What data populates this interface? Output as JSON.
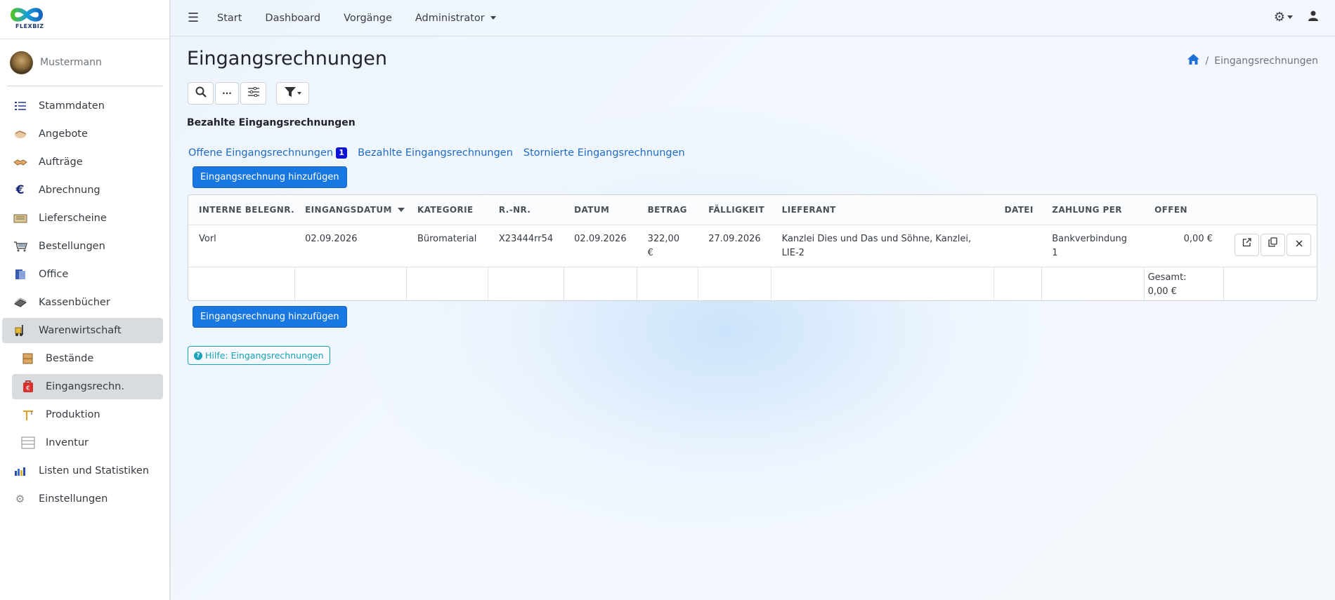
{
  "brand": {
    "name": "FLEXBIZ"
  },
  "user": {
    "name": "Mustermann"
  },
  "sidebar": {
    "items": [
      {
        "label": "Stammdaten",
        "icon": "list-icon"
      },
      {
        "label": "Angebote",
        "icon": "handshake-icon"
      },
      {
        "label": "Aufträge",
        "icon": "handshake-icon"
      },
      {
        "label": "Abrechnung",
        "icon": "euro-icon"
      },
      {
        "label": "Lieferscheine",
        "icon": "delivery-icon"
      },
      {
        "label": "Bestellungen",
        "icon": "cart-icon"
      },
      {
        "label": "Office",
        "icon": "book-icon"
      },
      {
        "label": "Kassenbücher",
        "icon": "cashbook-icon"
      },
      {
        "label": "Warenwirtschaft",
        "icon": "forklift-icon"
      }
    ],
    "subitems": [
      {
        "label": "Bestände",
        "icon": "boxes-icon"
      },
      {
        "label": "Eingangsrechn.",
        "icon": "invoice-icon"
      },
      {
        "label": "Produktion",
        "icon": "crane-icon"
      },
      {
        "label": "Inventur",
        "icon": "shelf-icon"
      }
    ],
    "bottom_items": [
      {
        "label": "Listen und Statistiken",
        "icon": "chart-icon"
      },
      {
        "label": "Einstellungen",
        "icon": "gear-icon"
      }
    ]
  },
  "topnav": {
    "start": "Start",
    "dashboard": "Dashboard",
    "vorgaenge": "Vorgänge",
    "admin": "Administrator"
  },
  "page": {
    "title": "Eingangsrechnungen",
    "breadcrumb_current": "Eingangsrechnungen",
    "section_title": "Bezahlte Eingangsrechnungen",
    "toolbar_more": "···"
  },
  "tabs": {
    "offene": "Offene Eingangsrechnungen",
    "offene_count": "1",
    "bezahlte": "Bezahlte Eingangsrechnungen",
    "stornierte": "Stornierte Eingangsrechnungen"
  },
  "buttons": {
    "add_top": "Eingangsrechnung hinzufügen",
    "add_bottom": "Eingangsrechnung hinzufügen",
    "help": "Hilfe: Eingangsrechnungen"
  },
  "table": {
    "headers": {
      "belegnr": "INTERNE BELEGNR.",
      "eingangsdatum": "EINGANGSDATUM",
      "kategorie": "KATEGORIE",
      "rnr": "R.-NR.",
      "datum": "DATUM",
      "betrag": "BETRAG",
      "faelligkeit": "FÄLLIGKEIT",
      "lieferant": "LIEFERANT",
      "datei": "DATEI",
      "zahlung": "ZAHLUNG PER",
      "offen": "OFFEN"
    },
    "rows": [
      {
        "belegnr": "Vorl",
        "eingangsdatum": "02.09.2026",
        "kategorie": "Büromaterial",
        "rnr": "X23444rr54",
        "datum": "02.09.2026",
        "betrag": "322,00 €",
        "faelligkeit": "27.09.2026",
        "lieferant": "Kanzlei Dies und Das und Söhne, Kanzlei, LIE-2",
        "datei": "",
        "zahlung": "Bankverbindung 1",
        "offen": "0,00 €"
      }
    ],
    "total_label": "Gesamt:",
    "total_value": "0,00 €"
  }
}
